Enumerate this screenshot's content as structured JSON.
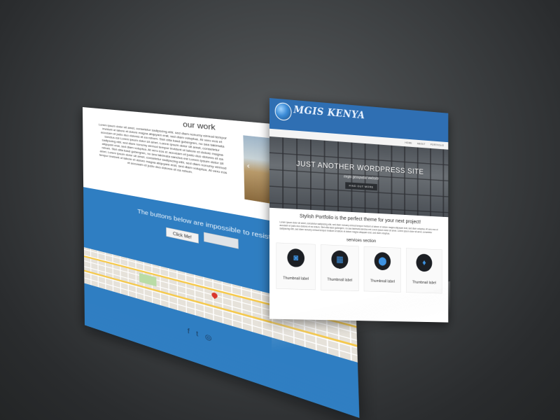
{
  "back_page": {
    "section_title": "our work",
    "work_text": "Lorem ipsum dolor sit amet, consetetur sadipscing elitr, sed diam nonumy eirmod tempor invidunt ut labore et dolore magna aliquyam erat, sed diam voluptua. At vero eos et accusam et justo duo dolores et ea rebum. Stet clita kasd gubergren, no sea takimata sanctus est Lorem ipsum dolor sit amet. Lorem ipsum dolor sit amet, consetetur sadipscing elitr, sed diam nonumy eirmod tempor invidunt ut labore et dolore magna aliquyam erat, sed diam voluptua. At vero eos et accusam et justo duo dolores et ea rebum. Stet clita kasd gubergren, no sea takimata sanctus est Lorem ipsum dolor sit amet. Lorem ipsum dolor sit amet, consetetur sadipscing elitr, sed diam nonumy eirmod tempor invidunt ut labore et dolore magna aliquyam erat, sed diam voluptua. At vero eos et accusam et justo duo dolores et ea rebum.",
    "cta_text": "The buttons below are impossible to resist!",
    "cta_button_primary": "Click Me!",
    "cta_button_secondary": "",
    "footer_social_icons": [
      "facebook-icon",
      "twitter-icon",
      "dribbble-icon"
    ]
  },
  "front_page": {
    "brand": "MGIS KENYA",
    "nav": [
      "HOME",
      "ABOUT",
      "PORTFOLIO"
    ],
    "hero_title": "JUST ANOTHER WORDPRESS SITE",
    "hero_tagline": "mrgis geospatial website",
    "hero_button": "FIND OUT MORE",
    "intro_title": "Stylish Portfolio is the perfect theme for your next project!",
    "intro_text": "Lorem ipsum dolor sit amet, consetetur sadipscing elitr, sed diam nonumy eirmod tempor invidunt ut labore et dolore magna aliquyam erat, sed diam voluptua. At vero eos et accusam et justo duo dolores et ea rebum. Stet clita kasd gubergren, no sea takimata sanctus est Lorem ipsum dolor sit amet. Lorem ipsum dolor sit amet, consetetur sadipscing elitr, sed diam nonumy eirmod tempor invidunt ut labore et dolore magna aliquyam erat, sed diam voluptua.",
    "services_title": "services section",
    "services": [
      {
        "label": "Thumbnail label",
        "icon": "camera-icon"
      },
      {
        "label": "Thumbnail label",
        "icon": "map-icon"
      },
      {
        "label": "Thumbnail label",
        "icon": "map-marker-icon"
      },
      {
        "label": "Thumbnail label",
        "icon": "pin-icon"
      }
    ]
  },
  "colors": {
    "background": "#3f4244",
    "brand_blue": "#2f7ec2",
    "header_blue": "#2f6fb3",
    "icon_blue": "#3e93e2"
  }
}
